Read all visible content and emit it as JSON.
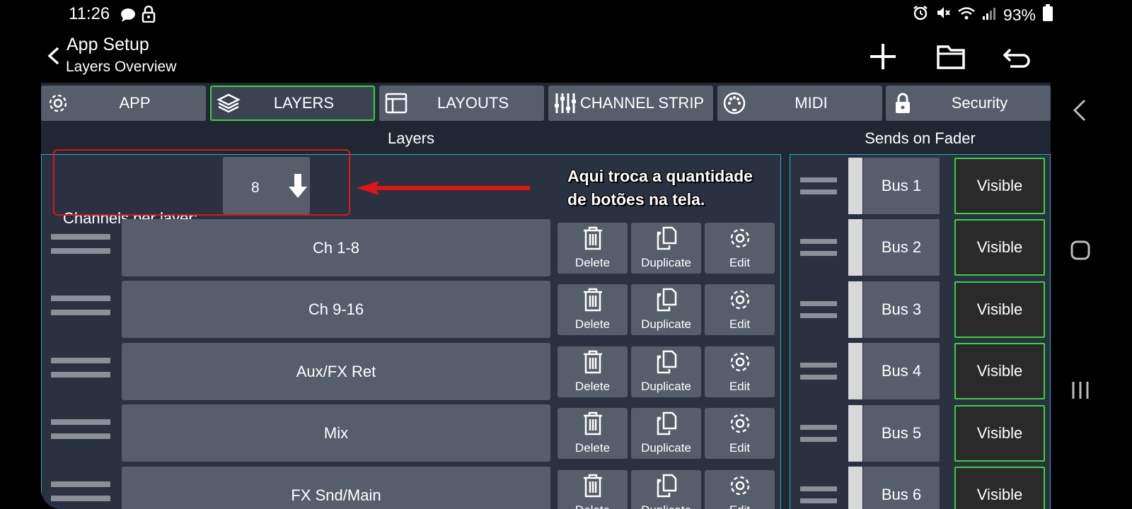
{
  "status_bar": {
    "time": "11:26",
    "battery": "93%",
    "icons": [
      "chat-icon",
      "lock-icon",
      "alarm-icon",
      "mute-icon",
      "wifi-icon",
      "signal-icon",
      "battery-icon"
    ]
  },
  "app_bar": {
    "title": "App Setup",
    "subtitle": "Layers Overview",
    "actions": [
      "add-icon",
      "folder-icon",
      "undo-icon"
    ]
  },
  "tabs": [
    {
      "label": "APP",
      "icon": "gear-icon",
      "active": false
    },
    {
      "label": "LAYERS",
      "icon": "layers-icon",
      "active": true
    },
    {
      "label": "LAYOUTS",
      "icon": "layout-icon",
      "active": false
    },
    {
      "label": "CHANNEL STRIP",
      "icon": "sliders-icon",
      "active": false
    },
    {
      "label": "MIDI",
      "icon": "midi-icon",
      "active": false
    },
    {
      "label": "Security",
      "icon": "lock-icon",
      "active": false
    }
  ],
  "layers_section": {
    "title": "Layers",
    "channels_per_layer_label": "Channels per layer:",
    "channels_per_layer_value": "8",
    "layers": [
      "Ch 1-8",
      "Ch 9-16",
      "Aux/FX Ret",
      "Mix",
      "FX Snd/Main"
    ],
    "actions": {
      "delete": "Delete",
      "duplicate": "Duplicate",
      "edit": "Edit"
    }
  },
  "sends_section": {
    "title": "Sends on Fader",
    "buses": [
      "Bus 1",
      "Bus 2",
      "Bus 3",
      "Bus 4",
      "Bus 5",
      "Bus 6"
    ],
    "visible_label": "Visible"
  },
  "annotation": {
    "line1": "Aqui troca a quantidade",
    "line2": "de botões na tela.",
    "color": "#e01515"
  },
  "colors": {
    "accent_green": "#3bd23d",
    "panel_border": "#1cb2bd",
    "button_gray": "#565d6b"
  }
}
